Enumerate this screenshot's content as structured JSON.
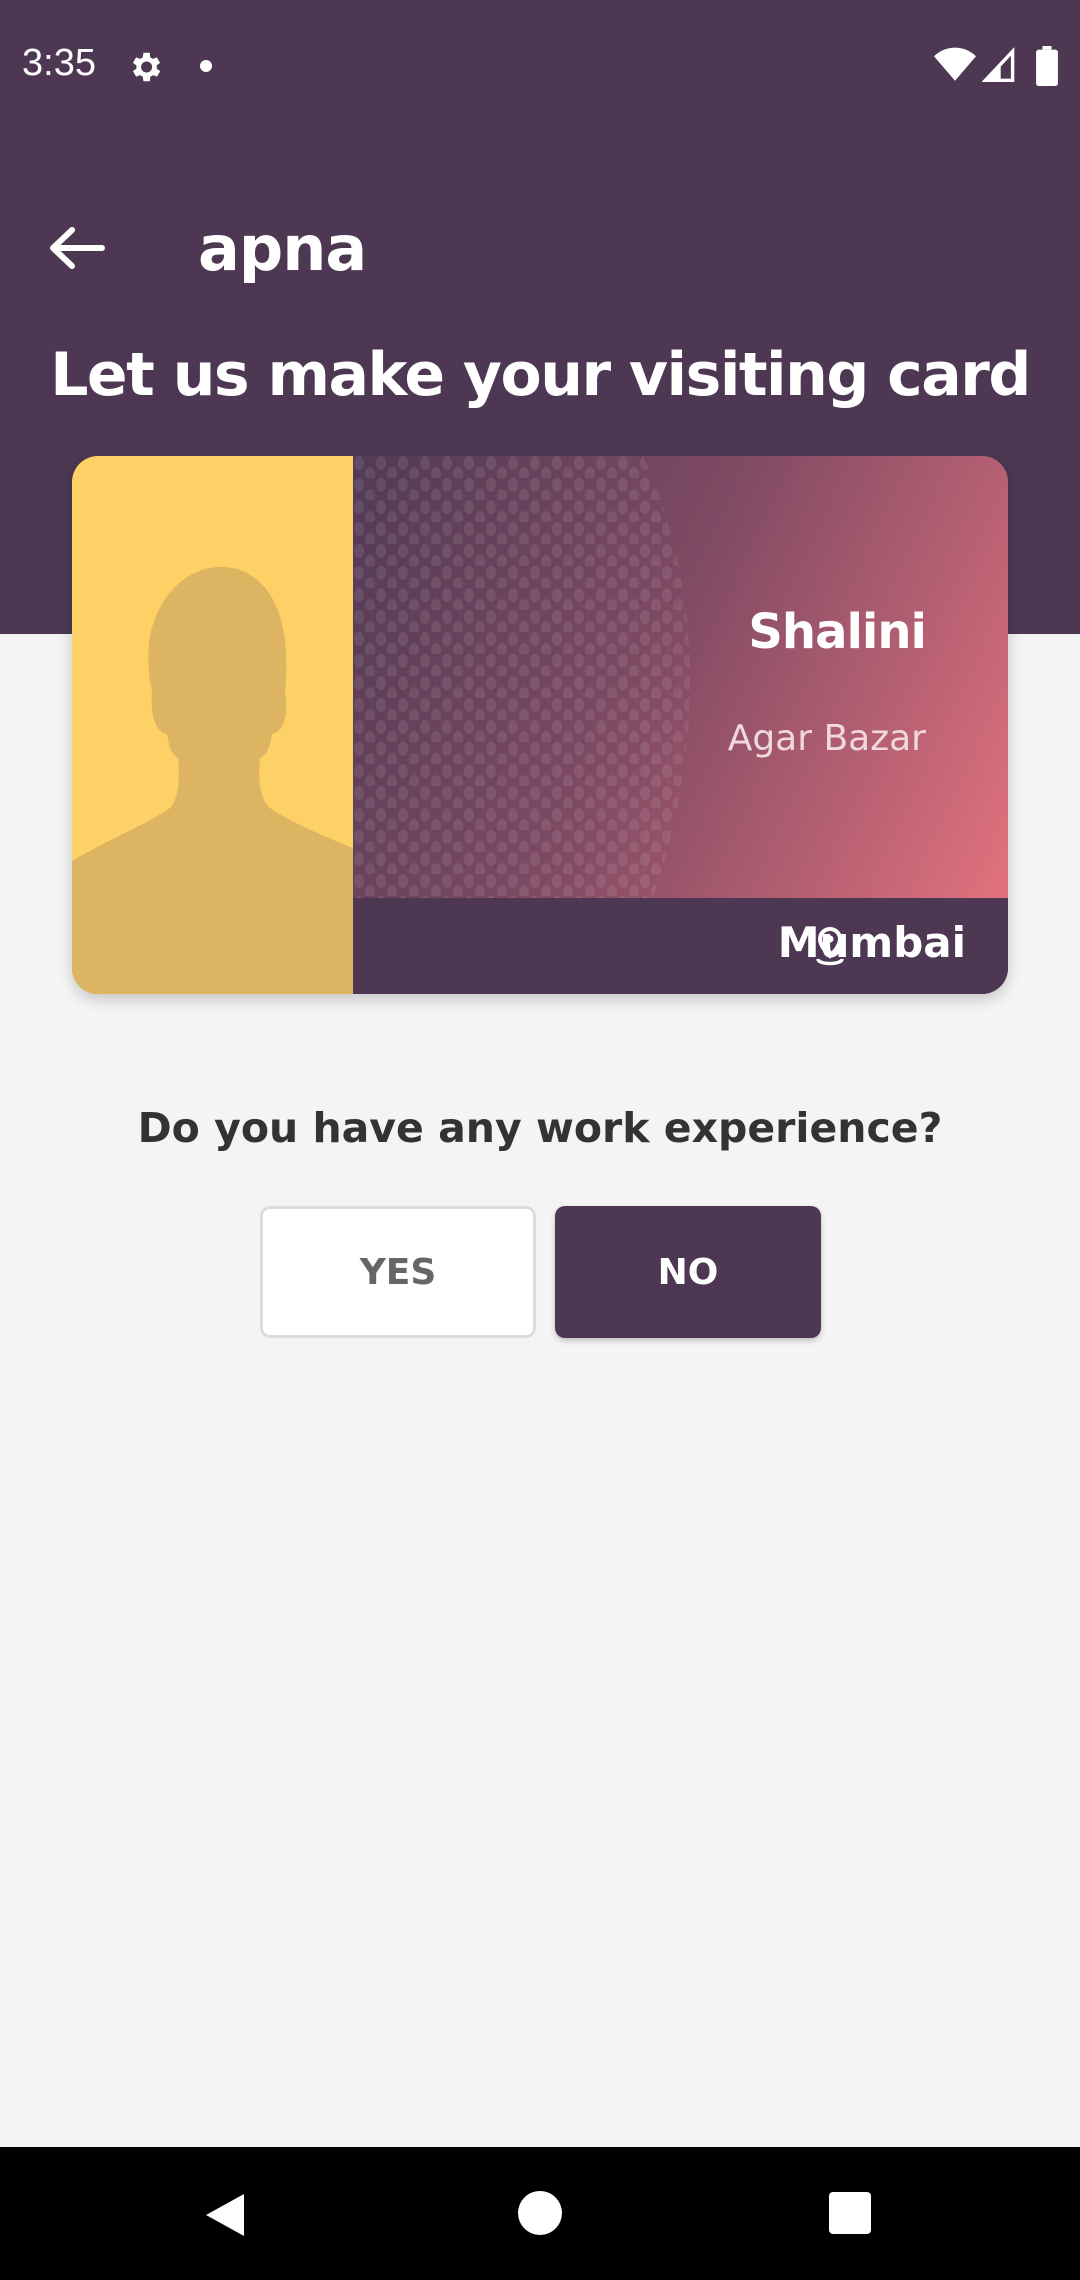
{
  "status_bar": {
    "time": "3:35",
    "icons": [
      "settings-gear-icon",
      "notification-dot-icon",
      "wifi-icon",
      "cellular-signal-icon",
      "battery-icon"
    ]
  },
  "app_bar": {
    "back_icon": "arrow-left-icon",
    "title": "apna"
  },
  "heading": "Let us make your visiting card",
  "visiting_card": {
    "photo_icon": "person-silhouette-icon",
    "name": "Shalini",
    "area": "Agar Bazar",
    "location_icon": "location-pin-icon",
    "city": "Mumbai"
  },
  "question": {
    "text": "Do you have any work experience?",
    "yes_label": "YES",
    "no_label": "NO",
    "selected": "NO"
  },
  "nav_bar": {
    "icons": [
      "nav-back-icon",
      "nav-home-icon",
      "nav-recents-icon"
    ]
  },
  "colors": {
    "primary": "#4d3752",
    "card_photo_bg": "#fed166",
    "silhouette": "#dcb462",
    "gradient_end": "#e2727d",
    "background": "#f4f4f4"
  }
}
